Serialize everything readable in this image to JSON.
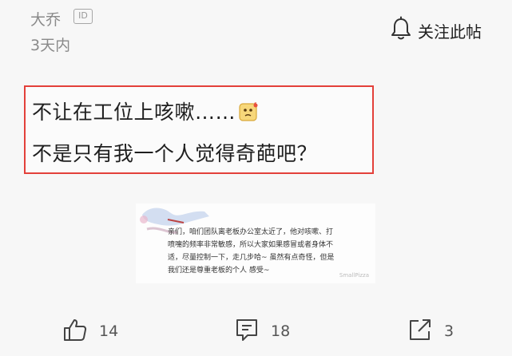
{
  "header": {
    "author": "大乔",
    "id_badge": "ID",
    "time": "3天内",
    "follow_label": "关注此帖"
  },
  "post": {
    "line1": "不让在工位上咳嗽……",
    "line2": "不是只有我一个人觉得奇葩吧？",
    "border_color": "#e3403a"
  },
  "image": {
    "text": "亲们，咱们团队离老板办公室太近了，他对咳嗽、打喷嚏的频率非常敏感，所以大家如果感冒或者身体不适，尽量控制一下，走几步哈~ 虽然有点奇怪，但是我们还是尊重老板的个人 感受~",
    "watermark": "SmallPizza"
  },
  "actions": {
    "like_count": "14",
    "comment_count": "18",
    "share_count": "3"
  },
  "icons": [
    "bell-icon",
    "thumbs-up-icon",
    "comment-icon",
    "share-icon",
    "emoji-icon"
  ]
}
